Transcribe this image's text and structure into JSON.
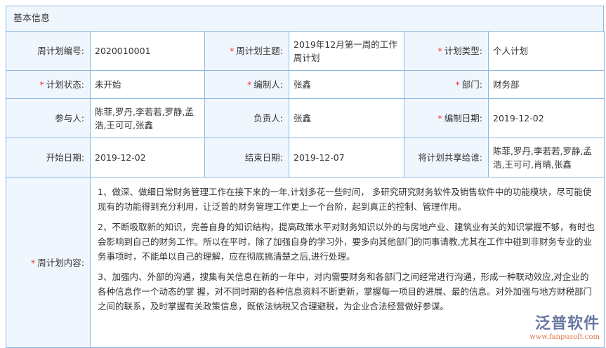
{
  "section_title": "基本信息",
  "rows": [
    [
      {
        "label": "周计划编号:",
        "required": false,
        "value": "2020010001"
      },
      {
        "label": "周计划主题:",
        "required": true,
        "value": "2019年12月第一周的工作周计划"
      },
      {
        "label": "计划类型:",
        "required": true,
        "value": "个人计划"
      }
    ],
    [
      {
        "label": "计划状态:",
        "required": true,
        "value": "未开始"
      },
      {
        "label": "编制人:",
        "required": true,
        "value": "张鑫"
      },
      {
        "label": "部门:",
        "required": true,
        "value": "财务部"
      }
    ],
    [
      {
        "label": "参与人:",
        "required": false,
        "value": "陈菲,罗丹,李若若,罗静,孟浩,王可可,张鑫"
      },
      {
        "label": "负责人:",
        "required": false,
        "value": "张鑫"
      },
      {
        "label": "编制日期:",
        "required": true,
        "value": "2019-12-02"
      }
    ],
    [
      {
        "label": "开始日期:",
        "required": false,
        "value": "2019-12-02"
      },
      {
        "label": "结束日期:",
        "required": false,
        "value": "2019-12-07"
      },
      {
        "label": "将计划共享给谁:",
        "required": false,
        "value": "陈菲,罗丹,李若若,罗静,孟浩,王可可,肖晴,张鑫"
      }
    ]
  ],
  "content": {
    "label": "周计划内容:",
    "paragraphs": [
      "1、做深、做细日常财务管理工作在接下来的一年,计划多花一些时间， 多研究研究财务软件及销售软件中的功能模块，尽可能使现有的功能得到充分利用，让泛普的财务管理工作更上一个台阶，起到真正的控制、管理作用。",
      "2、不断吸取新的知识，完善自身的知识结构，提高政策水平对财务知识以外的与房地产业、建筑业有关的知识掌握不够，有时也会影响到自己的财务工作。所以在平时，除了加强自身的学习外，要多向其他部门的同事请教,尤其在工作中碰到非财务专业的业务事项时，不能单以自己的理解，应在彻底搞清楚之后,进行处理。",
      "3、加强内、外部的沟通，搜集有关信息在新的一年中，对内需要财务和各部门之间经常进行沟通，形成一种联动效应,对企业的各种信息作一个动态的掌 握，对不同时期的各种信息资料不断更新，掌握每一项目的进展、最的信息。对外加强与地方财税部门之间的联系，及时掌握有关政策信息，既依法纳税又合理避税，为企业合法经营做好参谋。"
    ]
  },
  "logo": {
    "name": "泛普软件",
    "url": "www.fanpusoft.com"
  }
}
